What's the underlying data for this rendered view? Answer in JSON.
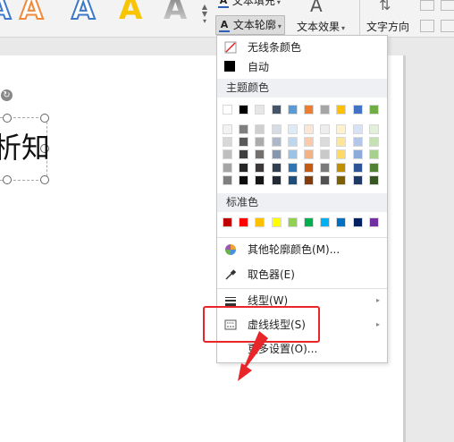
{
  "ribbon": {
    "text_fill_label": "文本填充",
    "text_outline_label": "文本轮廓",
    "text_effect_label": "文本效果",
    "text_direction_label": "文字方向",
    "style_samples": [
      "A",
      "A",
      "A",
      "A",
      "A"
    ]
  },
  "canvas": {
    "text_box_text": "析知"
  },
  "menu": {
    "no_line": "无线条颜色",
    "automatic": "自动",
    "theme_colors_header": "主题颜色",
    "standard_colors_header": "标准色",
    "more_outline_colors": "其他轮廓颜色(M)...",
    "eyedropper": "取色器(E)",
    "line_style": "线型(W)",
    "dash_style": "虚线线型(S)",
    "more_settings": "更多设置(O)...",
    "theme_top_row": [
      "#ffffff",
      "#000000",
      "#e7e6e6",
      "#44546a",
      "#5b9bd5",
      "#ed7d31",
      "#a5a5a5",
      "#ffc000",
      "#4472c4",
      "#70ad47"
    ],
    "theme_shades": [
      [
        "#f2f2f2",
        "#7f7f7f",
        "#d0cece",
        "#d6dce4",
        "#deebf6",
        "#fbe5d5",
        "#ededed",
        "#fff2cc",
        "#d9e2f3",
        "#e2efd9"
      ],
      [
        "#d8d8d8",
        "#595959",
        "#aeabab",
        "#adb9ca",
        "#bdd7ee",
        "#f7cbac",
        "#dbdbdb",
        "#fee599",
        "#b4c6e7",
        "#c5e0b3"
      ],
      [
        "#bfbfbf",
        "#3f3f3f",
        "#757070",
        "#8496b0",
        "#9cc3e5",
        "#f4b183",
        "#c9c9c9",
        "#ffd965",
        "#8eaadb",
        "#a8d08d"
      ],
      [
        "#a5a5a5",
        "#262626",
        "#3a3838",
        "#323f4f",
        "#2e75b5",
        "#c55a11",
        "#7b7b7b",
        "#bf9000",
        "#2f5496",
        "#538135"
      ],
      [
        "#7f7f7f",
        "#0c0c0c",
        "#171616",
        "#222a35",
        "#1e4e79",
        "#833c0b",
        "#525252",
        "#7f6000",
        "#1f3864",
        "#375623"
      ]
    ],
    "standard_colors": [
      "#c00000",
      "#ff0000",
      "#ffc000",
      "#ffff00",
      "#92d050",
      "#00b050",
      "#00b0f0",
      "#0070c0",
      "#002060",
      "#7030a0"
    ]
  },
  "annotation": {
    "highlight_color": "#e8262a"
  }
}
